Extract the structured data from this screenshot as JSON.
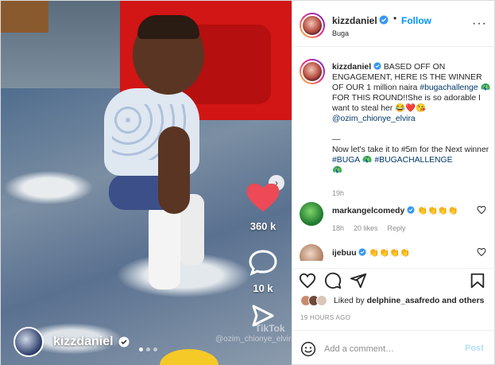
{
  "media": {
    "likes_count": "360 k",
    "comments_count": "10 k",
    "tiktok_watermark": "TikTok",
    "tiktok_handle": "@ozim_chionye_elvira.nk",
    "footer_username": "kizzdaniel",
    "carousel_dots": 3,
    "carousel_active_index": 0
  },
  "header": {
    "username": "kizzdaniel",
    "separator": "•",
    "follow_label": "Follow",
    "location": "Buga",
    "more_label": "···"
  },
  "caption": {
    "username": "kizzdaniel",
    "line1": "BASED OFF ON ENGAGEMENT, HERE IS THE WINNER OF OUR 1 million naira",
    "hashtag1": "#bugachallenge",
    "emoji1": "🦚",
    "line2": "FOR THIS ROUND!!She is so adorable I want to steal her",
    "emojis2": "😂❤️😘",
    "mention": "@ozim_chionye_elvira",
    "dash": "—",
    "line3": "Now let's take it to #5m for the Next winner",
    "hashtag2": "#BUGA",
    "emoji2": "🦚",
    "hashtag3": "#BUGACHALLENGE",
    "emoji3": "🦚",
    "time": "19h"
  },
  "comments": [
    {
      "username": "markangelcomedy",
      "text": "👏👏👏👏",
      "time": "18h",
      "likes": "20 likes",
      "reply": "Reply"
    },
    {
      "username": "ijebuu",
      "text": "👏👏👏👏",
      "time": "",
      "likes": "",
      "reply": ""
    }
  ],
  "liked_by": {
    "prefix": "Liked by",
    "user": "delphine_asafredo",
    "suffix": "and others"
  },
  "posted_ago": "19 HOURS AGO",
  "add_comment": {
    "placeholder": "Add a comment…",
    "post_label": "Post"
  },
  "colors": {
    "accent": "#0095f6",
    "like_red": "#ed4956",
    "post_disabled": "#b2dffc",
    "muted": "#8e8e8e"
  },
  "icons": [
    "heart-icon",
    "comment-icon",
    "share-icon",
    "bookmark-icon",
    "verified-icon",
    "emoji-icon",
    "more-icon",
    "next-arrow-icon"
  ]
}
